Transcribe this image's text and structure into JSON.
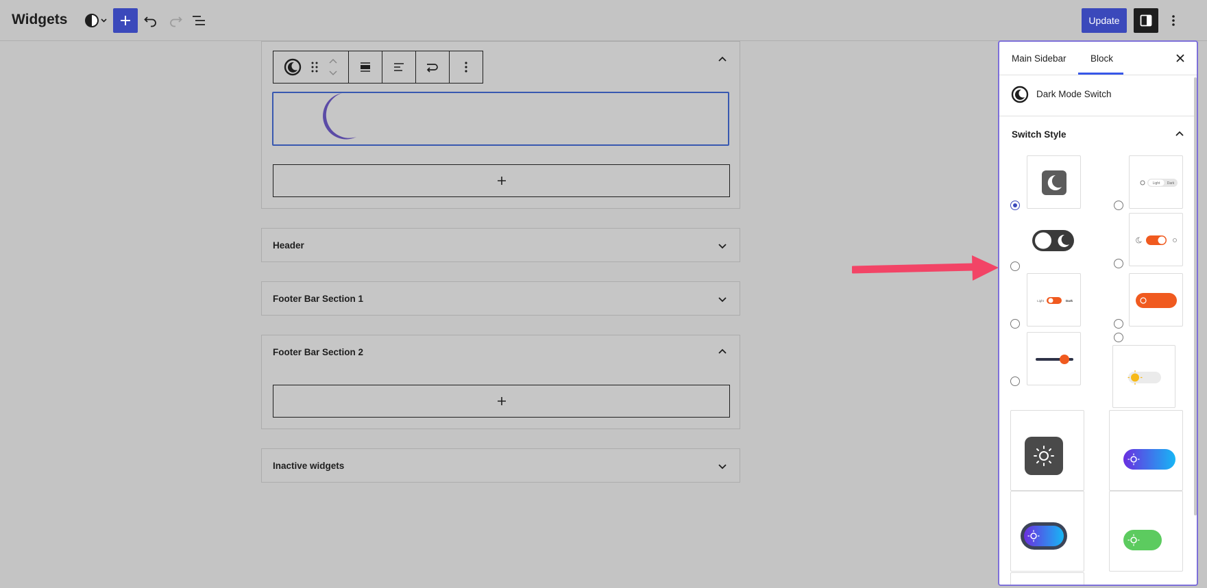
{
  "topbar": {
    "title": "Widgets",
    "update_label": "Update"
  },
  "editor": {
    "areas": [
      {
        "title": "Header"
      },
      {
        "title": "Footer Bar Section 1"
      },
      {
        "title": "Footer Bar Section 2"
      },
      {
        "title": "Inactive widgets"
      }
    ]
  },
  "sidebar": {
    "tabs": [
      {
        "label": "Main Sidebar"
      },
      {
        "label": "Block"
      }
    ],
    "active_tab": "Block",
    "block_name": "Dark Mode Switch",
    "section_title": "Switch Style",
    "switch_styles": [
      {
        "label": "",
        "selected": true
      },
      {
        "label": "Light / Dark"
      },
      {
        "label": ""
      },
      {
        "label": ""
      },
      {
        "label": "Light / Dark"
      },
      {
        "label": ""
      },
      {
        "label": ""
      },
      {
        "label": ""
      },
      {
        "label": ""
      },
      {
        "label": ""
      },
      {
        "label": ""
      },
      {
        "label": ""
      }
    ],
    "mini_labels": {
      "light": "Light",
      "dark": "Dark"
    }
  },
  "colors": {
    "accent": "#3b49bb",
    "moon": "#5b4ba6",
    "orange": "#f05a1f",
    "arrow": "#f24466"
  }
}
